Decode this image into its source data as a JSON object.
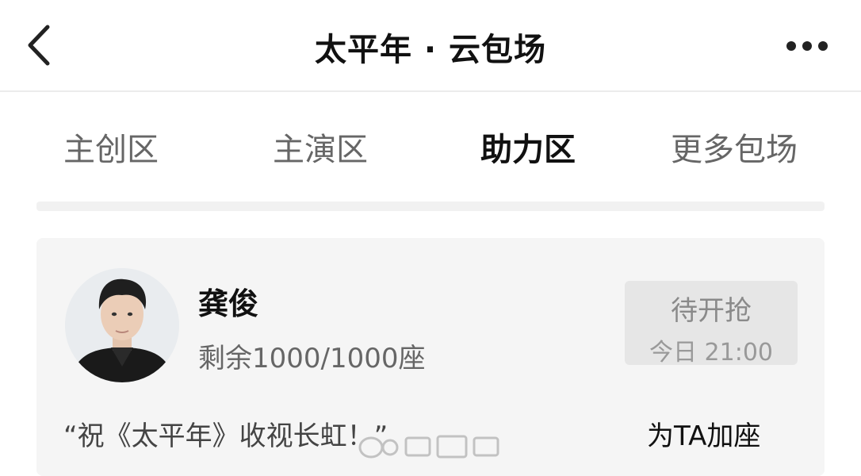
{
  "header": {
    "title": "太平年 · 云包场"
  },
  "tabs": [
    {
      "label": "主创区",
      "active": false
    },
    {
      "label": "主演区",
      "active": false
    },
    {
      "label": "助力区",
      "active": true
    },
    {
      "label": "更多包场",
      "active": false
    }
  ],
  "card": {
    "name": "龚俊",
    "remaining": "剩余1000/1000座",
    "button_title": "待开抢",
    "button_time": "今日 21:00",
    "quote": "“祝《太平年》收视长虹！”",
    "add_seat": "为TA加座"
  },
  "icons": {
    "back": "chevron-left-icon",
    "more": "more-dots-icon"
  },
  "colors": {
    "background": "#ffffff",
    "card": "#f5f5f5",
    "button": "#e6e6e6",
    "muted_text": "#666666"
  }
}
